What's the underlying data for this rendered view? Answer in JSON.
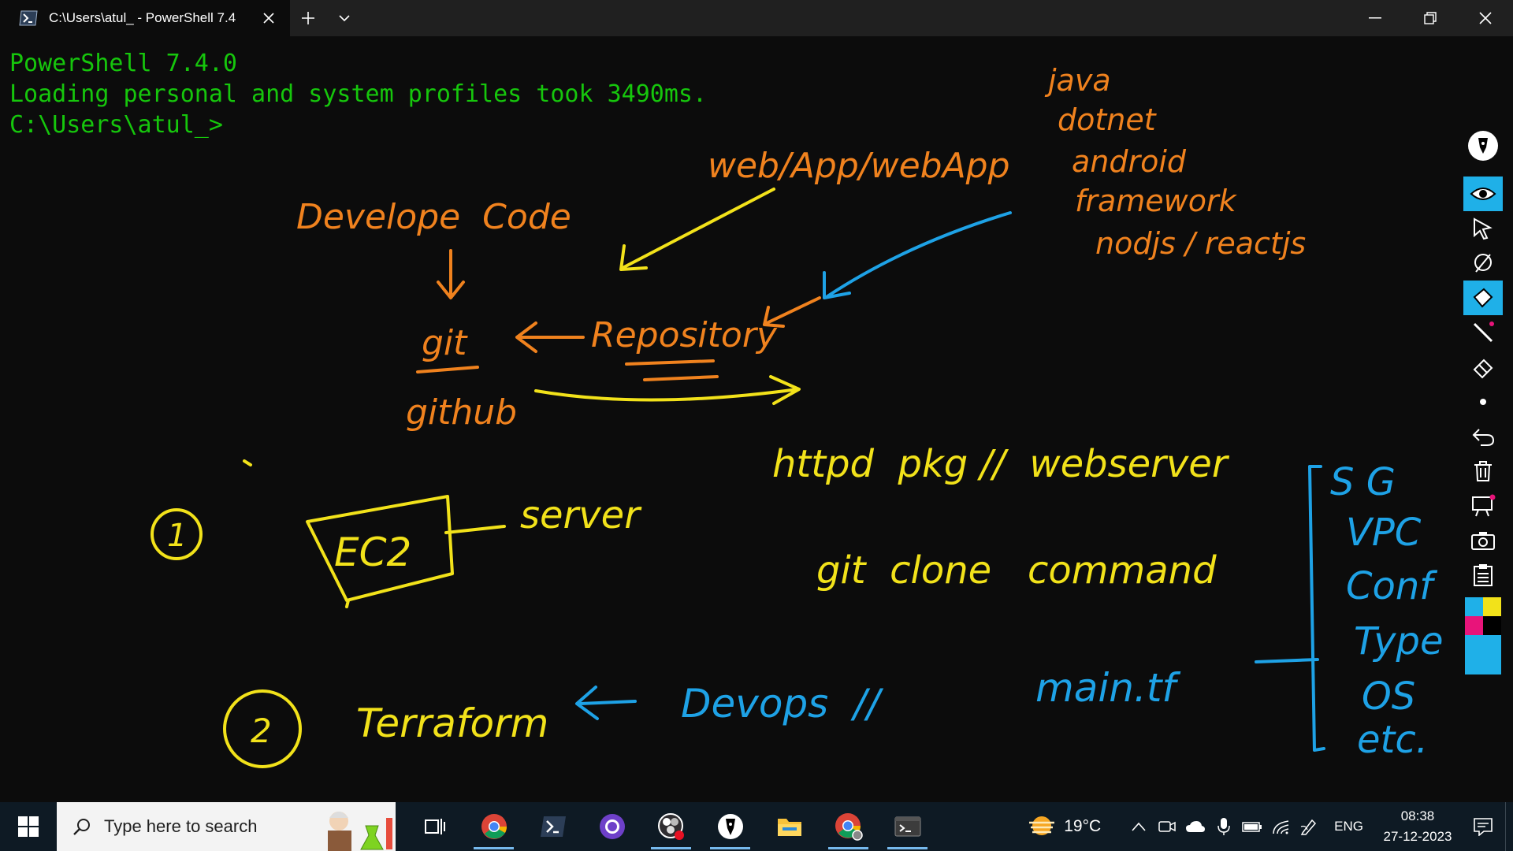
{
  "window": {
    "tab_title": "C:\\Users\\atul_ - PowerShell 7.4",
    "colors": {
      "titlebar": "#202020",
      "terminal_bg": "#0c0c0c",
      "terminal_text": "#16c60c"
    }
  },
  "terminal": {
    "lines": [
      "PowerShell 7.4.0",
      "Loading personal and system profiles took 3490ms.",
      "C:\\Users\\atul_>"
    ]
  },
  "ink": {
    "colors": {
      "orange": "#f0821e",
      "yellow": "#f2e21a",
      "blue": "#1ea2e6"
    },
    "notes": {
      "develope_code": "Develope  Code",
      "git": "git",
      "github": "github",
      "repository": "Repository",
      "web_app": "web/App/webApp",
      "java": "java",
      "dotnet": "dotnet",
      "android": "android",
      "framework": "framework",
      "nodejs": "nodjs / reactjs",
      "httpd": "httpd  pkg //  webserver",
      "num1": "1",
      "ec2": "EC2",
      "server": "server",
      "git_clone": "git  clone   command",
      "num2": "2",
      "terraform": "Terraform",
      "devops": "Devops  //",
      "main_tf": "main.tf",
      "sg": "S G",
      "vpc": "VPC",
      "conf": "Conf",
      "type": "Type",
      "os": "OS",
      "etc": "etc."
    }
  },
  "ink_toolbar": {
    "tools": [
      "pen-icon",
      "eye-icon",
      "pointer-icon",
      "lasso-icon",
      "highlighter-icon",
      "line-icon",
      "eraser-icon",
      "dot-icon",
      "undo-icon",
      "trash-icon",
      "whiteboard-icon",
      "camera-icon",
      "clipboard-icon"
    ],
    "palette": [
      "#1fb0e8",
      "#f2e21a",
      "#e8147a",
      "#000000",
      "#1fb0e8"
    ]
  },
  "taskbar": {
    "search_placeholder": "Type here to search",
    "apps": [
      "task-view-icon",
      "chrome-icon",
      "powershell-icon",
      "github-desktop-icon",
      "obs-icon",
      "pen-app-icon",
      "file-explorer-icon",
      "chrome-profile-icon",
      "terminal-icon"
    ],
    "weather_temp": "19°C",
    "language": "ENG",
    "time": "08:38",
    "date": "27-12-2023"
  }
}
